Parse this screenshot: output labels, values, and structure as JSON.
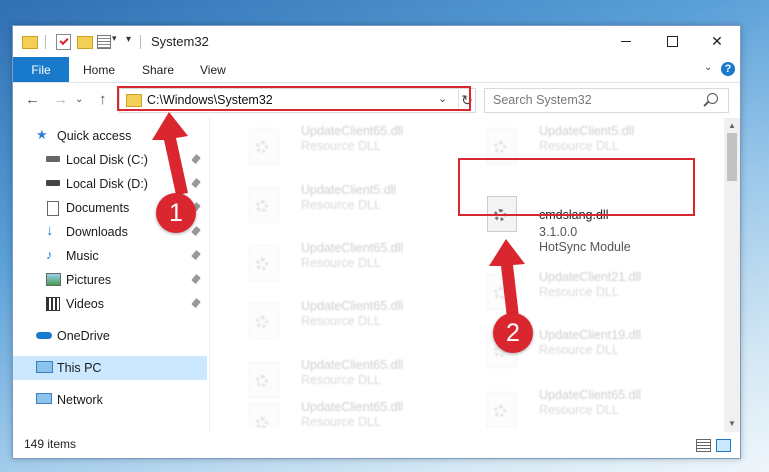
{
  "window": {
    "title": "System32",
    "controls": {
      "minimize": "minimize",
      "maximize": "maximize",
      "close": "✕"
    }
  },
  "ribbon": {
    "tabs": [
      "File",
      "Home",
      "Share",
      "View"
    ],
    "help": "?"
  },
  "navigation": {
    "address": "C:\\Windows\\System32",
    "search_placeholder": "Search System32"
  },
  "sidebar": {
    "items": [
      {
        "label": "Quick access",
        "icon": "star-icon",
        "pinned": false
      },
      {
        "label": "Local Disk (C:)",
        "icon": "drive-icon",
        "pinned": true
      },
      {
        "label": "Local Disk (D:)",
        "icon": "drive-icon",
        "pinned": true
      },
      {
        "label": "Documents",
        "icon": "documents-icon",
        "pinned": true
      },
      {
        "label": "Downloads",
        "icon": "download-icon",
        "pinned": true
      },
      {
        "label": "Music",
        "icon": "music-icon",
        "pinned": true
      },
      {
        "label": "Pictures",
        "icon": "pictures-icon",
        "pinned": true
      },
      {
        "label": "Videos",
        "icon": "videos-icon",
        "pinned": true
      },
      {
        "label": "OneDrive",
        "icon": "cloud-icon",
        "pinned": false
      },
      {
        "label": "This PC",
        "icon": "computer-icon",
        "pinned": false,
        "selected": true
      },
      {
        "label": "Network",
        "icon": "network-icon",
        "pinned": false
      }
    ]
  },
  "files": {
    "left_column": [
      {
        "name": "UpdateClient65.dll",
        "desc": "Resource DLL"
      },
      {
        "name": "UpdateClient5.dll",
        "desc": "Resource DLL"
      },
      {
        "name": "UpdateClient65.dll",
        "desc": "Resource DLL"
      },
      {
        "name": "UpdateClient65.dll",
        "desc": "Resource DLL"
      },
      {
        "name": "UpdateClient65.dll",
        "desc": "Resource DLL"
      },
      {
        "name": "UpdateClient65.dll",
        "desc": "Resource DLL"
      }
    ],
    "right_column": [
      {
        "name": "UpdateClient5.dll",
        "desc": "Resource DLL"
      },
      {
        "name": "UpdateClient21.dll",
        "desc": "Resource DLL"
      },
      {
        "name": "UpdateClient19.dll",
        "desc": "Resource DLL"
      },
      {
        "name": "UpdateClient65.dll",
        "desc": "Resource DLL"
      }
    ],
    "highlighted": {
      "name": "cmdslang.dll",
      "version": "3.1.0.0",
      "desc": "HotSync Module"
    }
  },
  "status": {
    "count": "149 items"
  },
  "annotations": {
    "step1": "1",
    "step2": "2",
    "color": "#d9262f"
  }
}
